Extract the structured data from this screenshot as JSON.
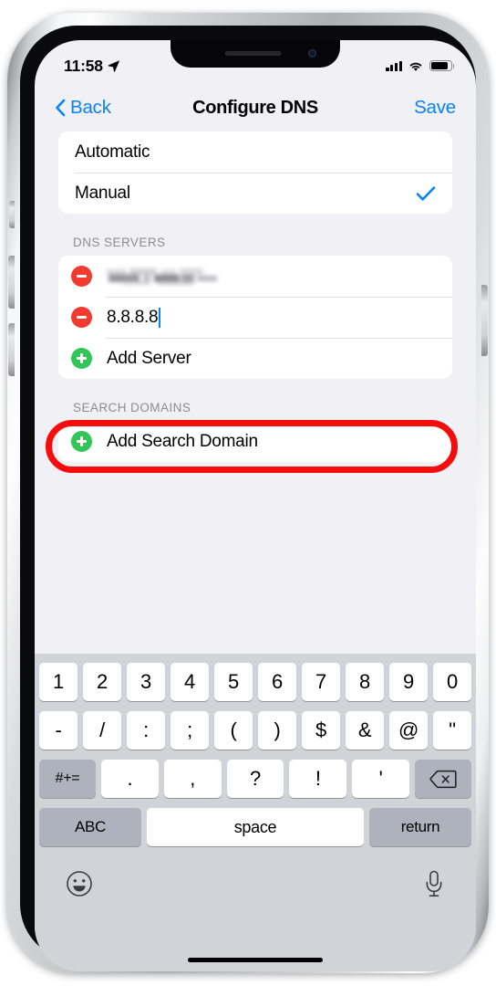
{
  "status_bar": {
    "time": "11:58",
    "location_icon": "location-arrow-icon",
    "signal_icon": "cellular-signal-icon",
    "wifi_icon": "wifi-icon",
    "battery_icon": "battery-icon"
  },
  "nav": {
    "back_label": "Back",
    "back_icon": "chevron-left-icon",
    "title": "Configure DNS",
    "save_label": "Save"
  },
  "mode_section": {
    "options": [
      {
        "label": "Automatic",
        "selected": false
      },
      {
        "label": "Manual",
        "selected": true
      }
    ],
    "checkmark_icon": "checkmark-icon"
  },
  "dns_servers": {
    "header": "DNS SERVERS",
    "entries": [
      {
        "value": "",
        "redacted": true,
        "delete_icon": "minus-circle-icon"
      },
      {
        "value": "8.8.8.8",
        "redacted": false,
        "delete_icon": "minus-circle-icon",
        "editing": true
      }
    ],
    "add_label": "Add Server",
    "add_icon": "plus-circle-icon"
  },
  "search_domains": {
    "header": "SEARCH DOMAINS",
    "add_label": "Add Search Domain",
    "add_icon": "plus-circle-icon"
  },
  "annotation": {
    "shape": "oval-highlight",
    "color": "#f50c0c"
  },
  "keyboard": {
    "row1": [
      "1",
      "2",
      "3",
      "4",
      "5",
      "6",
      "7",
      "8",
      "9",
      "0"
    ],
    "row2": [
      "-",
      "/",
      ":",
      ";",
      "(",
      ")",
      "$",
      "&",
      "@",
      "\""
    ],
    "row3_symbols_label": "#+=",
    "row3": [
      ".",
      ",",
      "?",
      "!",
      "'"
    ],
    "delete_icon": "backspace-icon",
    "abc_label": "ABC",
    "space_label": "space",
    "return_label": "return",
    "emoji_icon": "emoji-smiley-icon",
    "mic_icon": "microphone-icon"
  },
  "colors": {
    "accent_blue": "#0a82f8",
    "delete_red": "#f03b2e",
    "add_green": "#32c658",
    "annotation_red": "#f50c0c"
  }
}
